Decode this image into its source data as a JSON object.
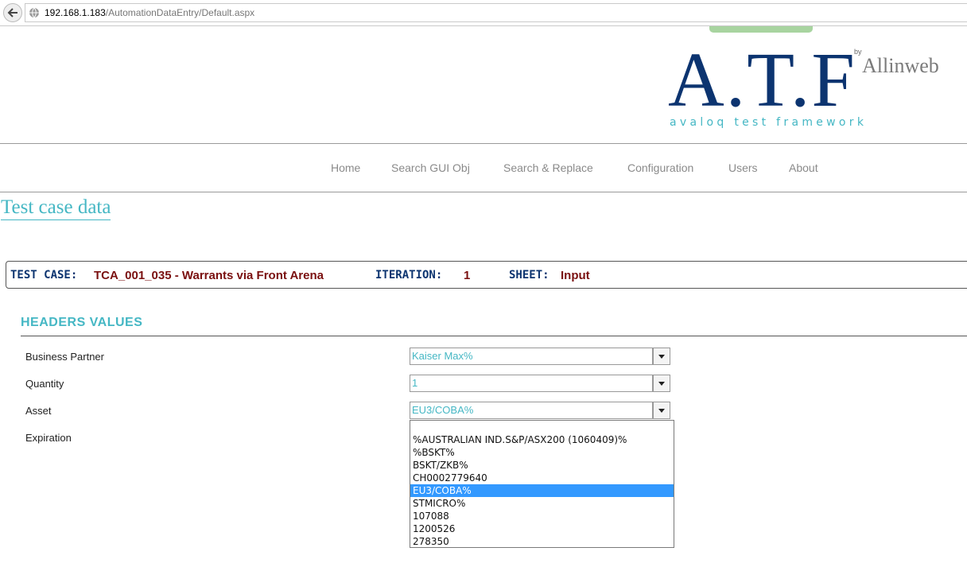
{
  "browser": {
    "url_host": "192.168.1.183",
    "url_path": "/AutomationDataEntry/Default.aspx"
  },
  "logo": {
    "main": "A.T.F",
    "subtitle": "avaloq test framework",
    "by": "by",
    "brand": "Allinweb"
  },
  "nav": [
    "Home",
    "Search GUI Obj",
    "Search & Replace",
    "Configuration",
    "Users",
    "About"
  ],
  "page_title": "Test case data",
  "info": {
    "test_case_label": "TEST CASE:",
    "test_case_value": "TCA_001_035 - Warrants via Front Arena",
    "iteration_label": "ITERATION:",
    "iteration_value": "1",
    "sheet_label": "SHEET:",
    "sheet_value": "Input"
  },
  "section_title": "HEADERS VALUES",
  "fields": [
    {
      "label": "Business Partner",
      "value": "Kaiser Max%"
    },
    {
      "label": "Quantity",
      "value": "1"
    },
    {
      "label": "Asset",
      "value": "EU3/COBA%"
    },
    {
      "label": "Expiration",
      "value": ""
    }
  ],
  "dropdown_options": [
    "",
    "%AUSTRALIAN IND.S&P/ASX200 (1060409)%",
    "%BSKT%",
    "BSKT/ZKB%",
    "CH0002779640",
    "EU3/COBA%",
    "STMICRO%",
    "107088",
    "1200526",
    "278350"
  ],
  "dropdown_selected": "EU3/COBA%",
  "colors": {
    "navy": "#0c3470",
    "teal": "#45b7c4",
    "maroon": "#7a1010",
    "highlight": "#3399ff"
  }
}
